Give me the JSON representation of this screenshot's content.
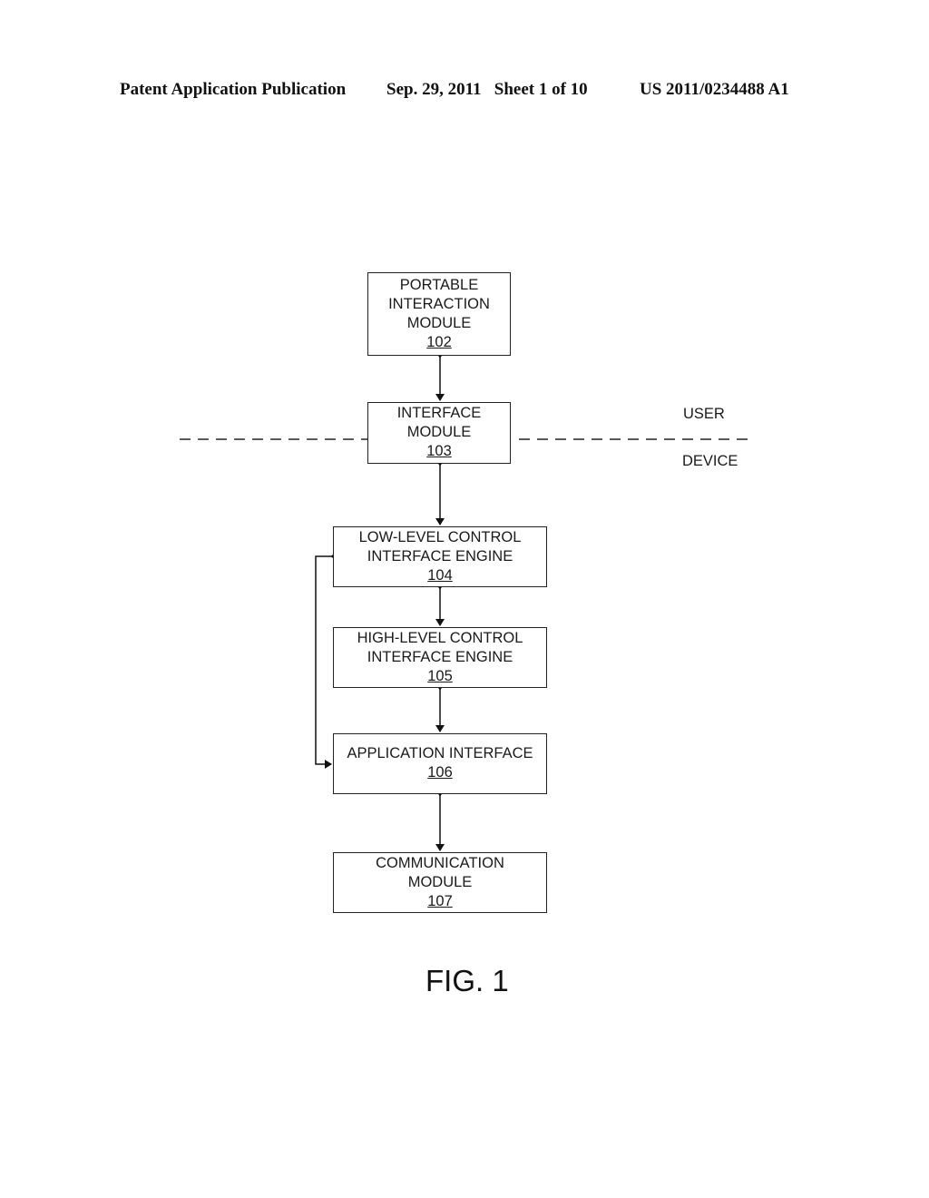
{
  "header": {
    "publication": "Patent Application Publication",
    "date_sheet": "Sep. 29, 2011   Sheet 1 of 10",
    "number": "US 2011/0234488 A1"
  },
  "diagram": {
    "nodes": [
      {
        "id": "102",
        "lines": [
          "PORTABLE",
          "INTERACTION",
          "MODULE"
        ],
        "ref": "102"
      },
      {
        "id": "103",
        "lines": [
          "INTERFACE",
          "MODULE"
        ],
        "ref": "103"
      },
      {
        "id": "104",
        "lines": [
          "LOW-LEVEL CONTROL",
          "INTERFACE ENGINE"
        ],
        "ref": "104"
      },
      {
        "id": "105",
        "lines": [
          "HIGH-LEVEL CONTROL",
          "INTERFACE ENGINE"
        ],
        "ref": "105"
      },
      {
        "id": "106",
        "lines": [
          "APPLICATION INTERFACE"
        ],
        "ref": "106"
      },
      {
        "id": "107",
        "lines": [
          "COMMUNICATION",
          "MODULE"
        ],
        "ref": "107"
      }
    ],
    "edges": [
      {
        "from": "102",
        "to": "103",
        "type": "bidirectional"
      },
      {
        "from": "103",
        "to": "104",
        "type": "bidirectional"
      },
      {
        "from": "104",
        "to": "105",
        "type": "bidirectional"
      },
      {
        "from": "105",
        "to": "106",
        "type": "bidirectional"
      },
      {
        "from": "106",
        "to": "107",
        "type": "bidirectional"
      },
      {
        "from": "104",
        "to": "106",
        "type": "bidirectional-side-loop"
      }
    ],
    "zones": {
      "upper": "USER",
      "lower": "DEVICE"
    },
    "figure_label": "FIG. 1"
  }
}
